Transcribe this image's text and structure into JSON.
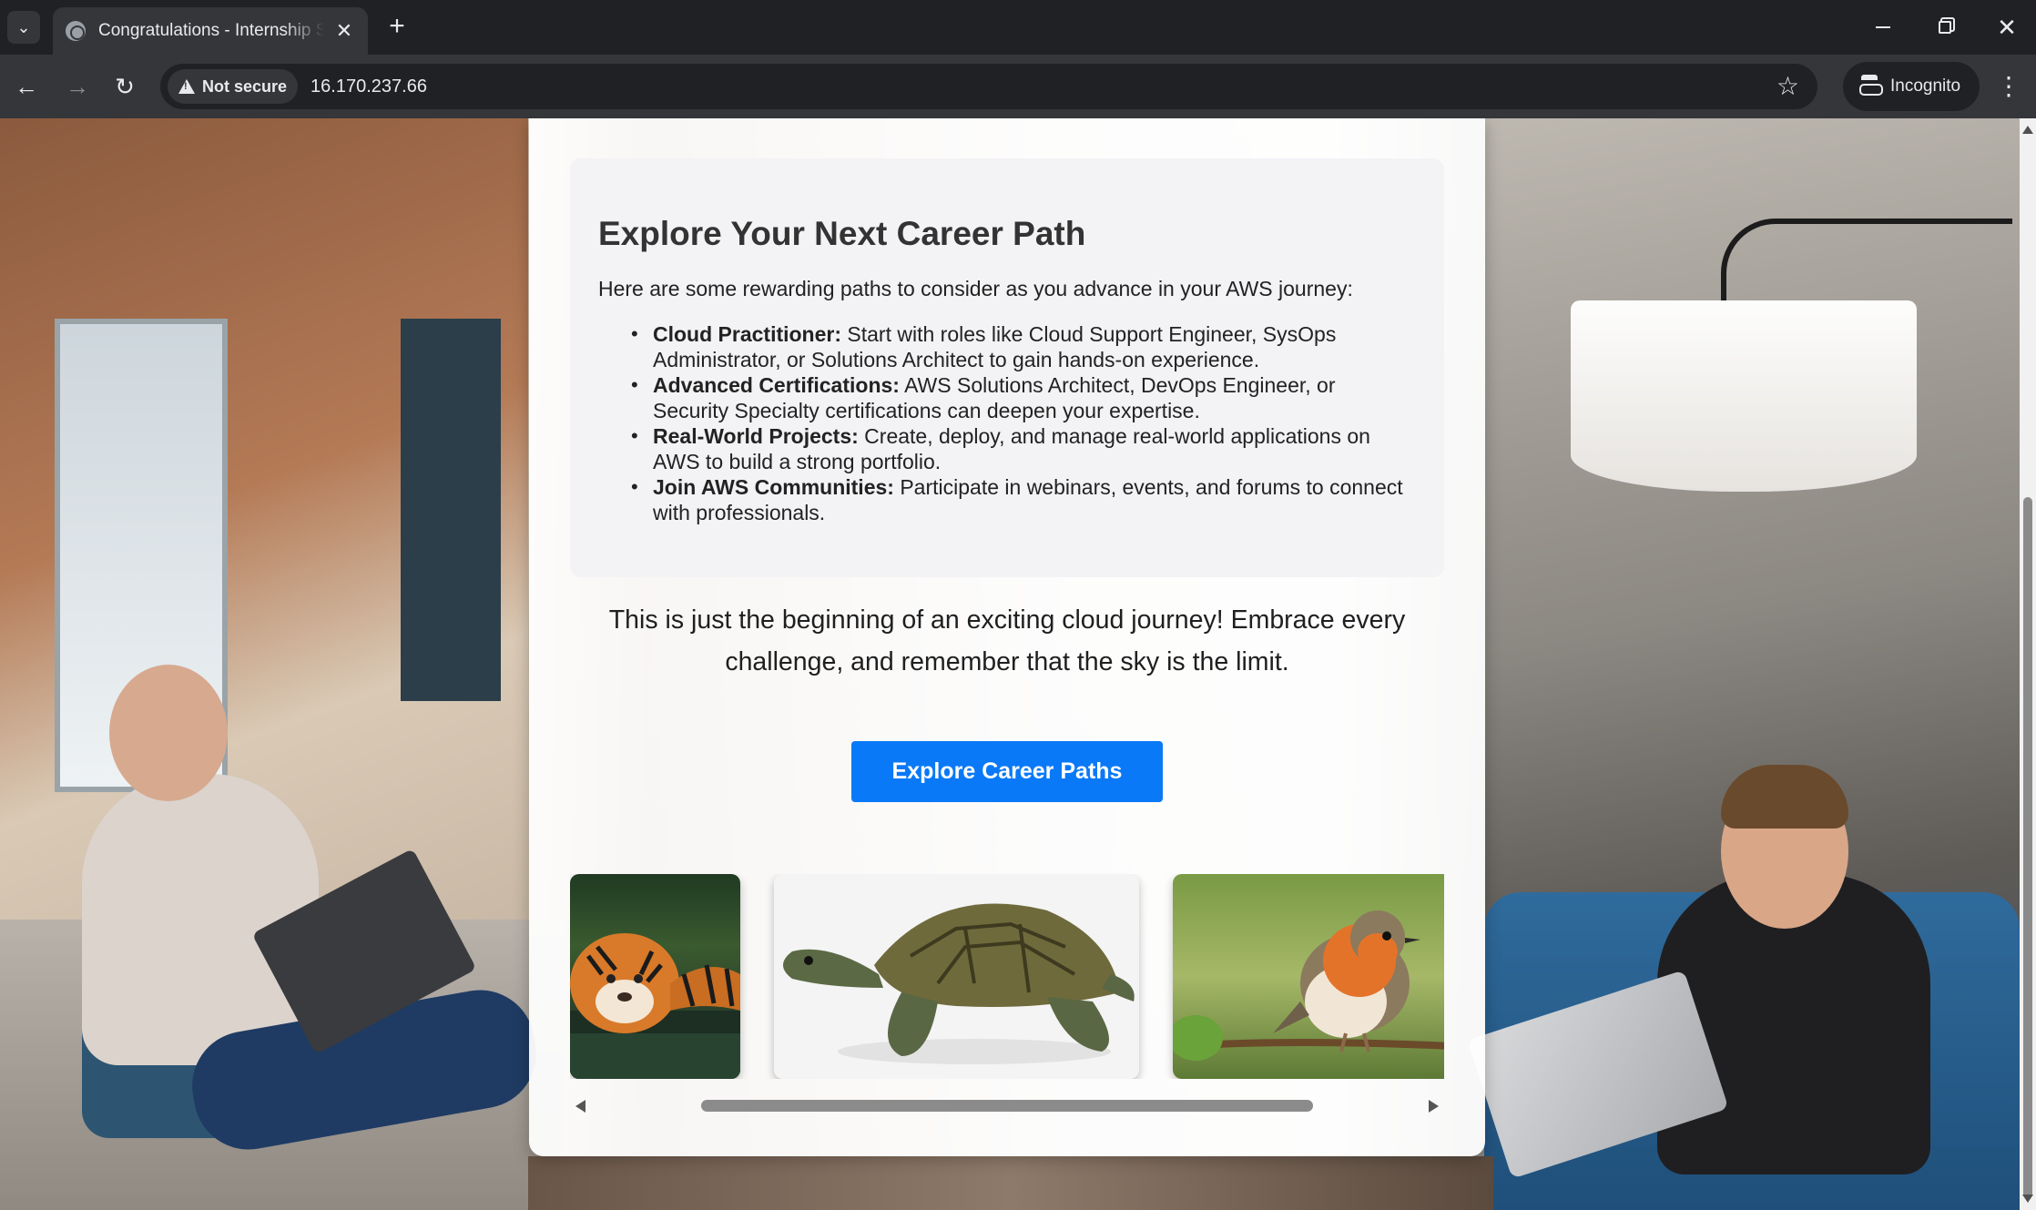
{
  "browser": {
    "tab_title": "Congratulations - Internship Student",
    "new_tab_symbol": "+",
    "tab_close_symbol": "✕",
    "security_label": "Not secure",
    "url": "16.170.237.66",
    "incognito_label": "Incognito"
  },
  "career": {
    "title": "Explore Your Next Career Path",
    "intro": "Here are some rewarding paths to consider as you advance in your AWS journey:",
    "items": [
      {
        "label": "Cloud Practitioner:",
        "text": " Start with roles like Cloud Support Engineer, SysOps Administrator, or Solutions Architect to gain hands-on experience."
      },
      {
        "label": "Advanced Certifications:",
        "text": " AWS Solutions Architect, DevOps Engineer, or Security Specialty certifications can deepen your expertise."
      },
      {
        "label": "Real-World Projects:",
        "text": " Create, deploy, and manage real-world applications on AWS to build a strong portfolio."
      },
      {
        "label": "Join AWS Communities:",
        "text": " Participate in webinars, events, and forums to connect with professionals."
      }
    ]
  },
  "journey_text": "This is just the beginning of an exciting cloud journey! Embrace every challenge, and remember that the sky is the limit.",
  "cta_label": "Explore Career Paths",
  "gallery": {
    "images": [
      "tiger-image",
      "turtle-image",
      "robin-image"
    ]
  },
  "colors": {
    "accent": "#0a79f7",
    "chrome_dark": "#202124",
    "chrome_mid": "#35363a"
  }
}
